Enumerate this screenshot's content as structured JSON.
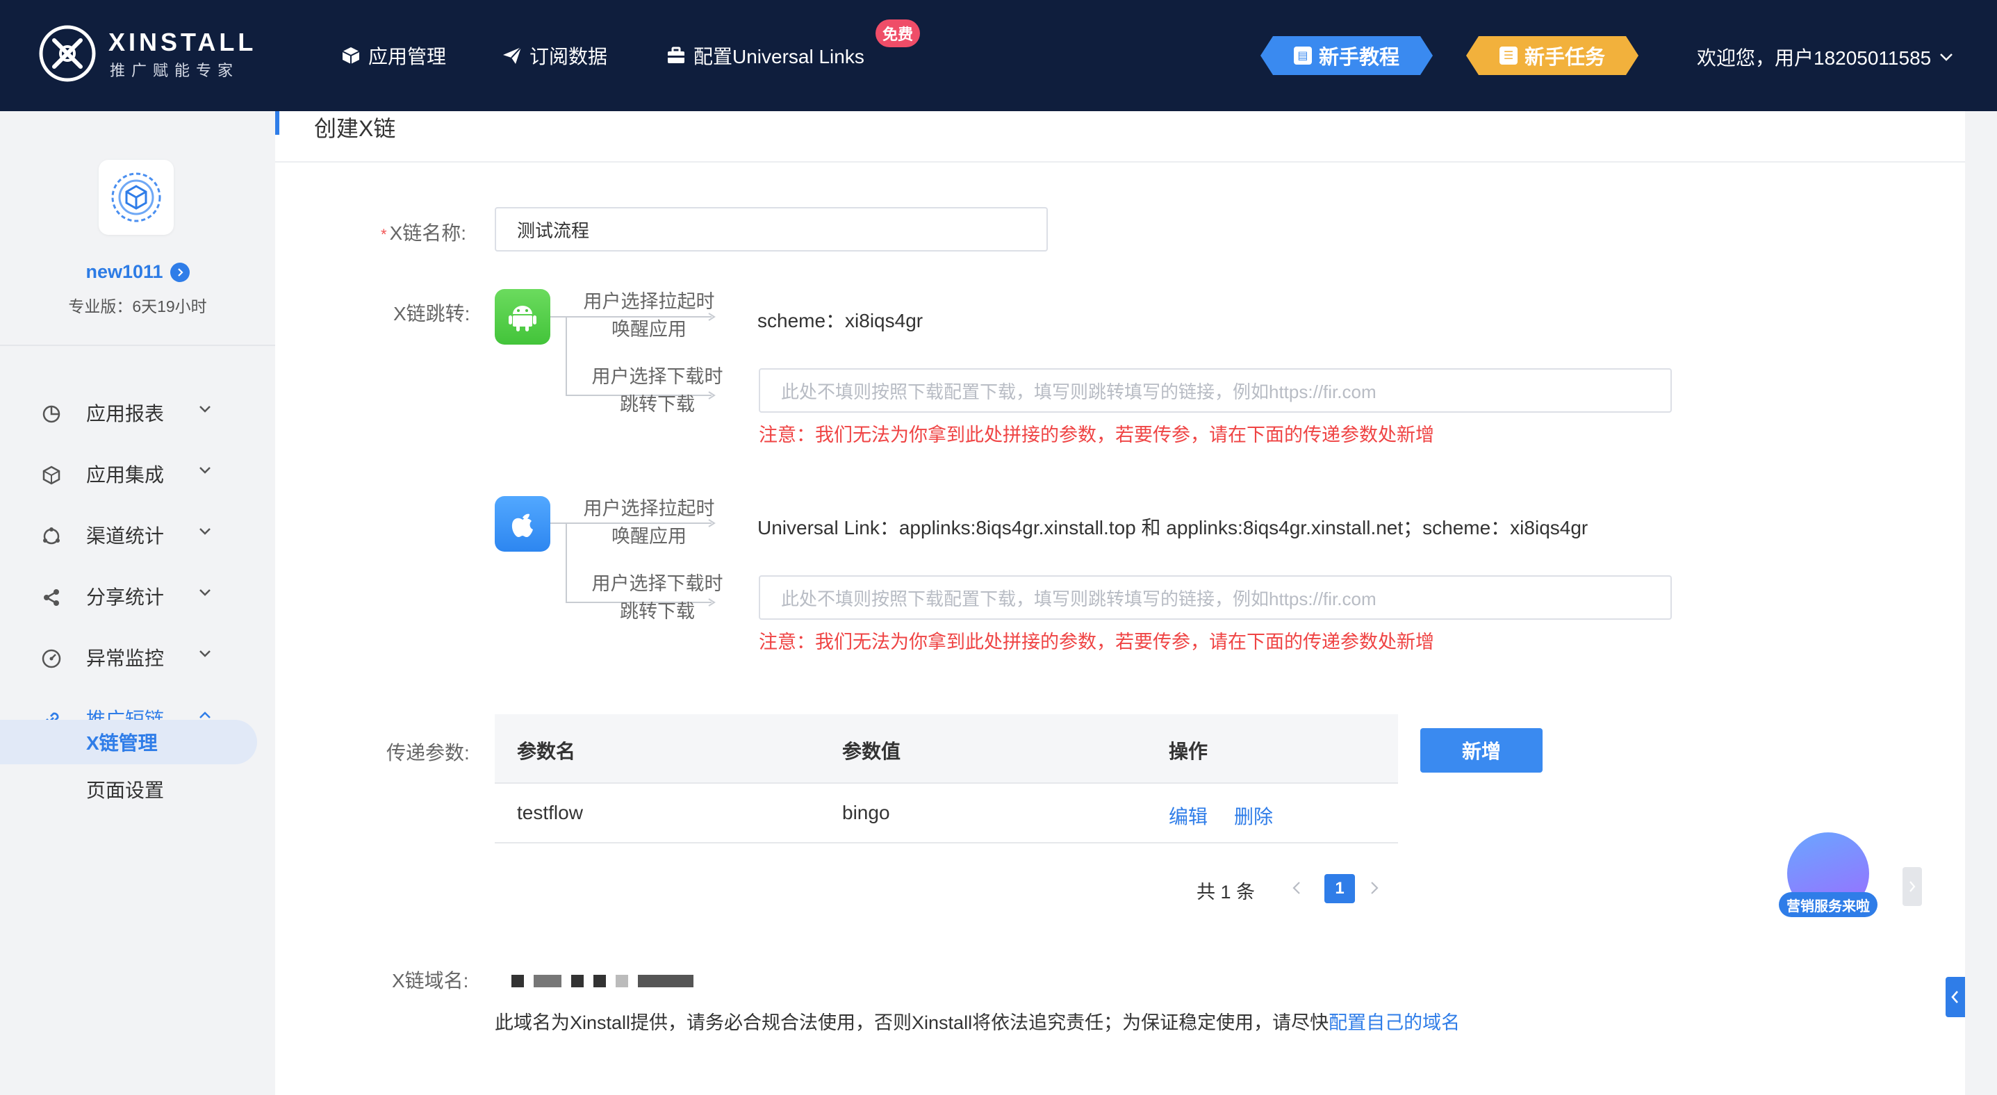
{
  "brand": {
    "name": "XINSTALL",
    "tagline": "推广赋能专家"
  },
  "nav": {
    "items": [
      {
        "label": "应用管理",
        "icon": "cube-icon"
      },
      {
        "label": "订阅数据",
        "icon": "paper-plane-icon"
      },
      {
        "label": "配置Universal Links",
        "icon": "toolbox-icon"
      }
    ],
    "free_badge": "免费",
    "tutorial": "新手教程",
    "task": "新手任务",
    "welcome": "欢迎您，用户18205011585"
  },
  "sidebar": {
    "username": "new1011",
    "plan": "专业版：6天19小时",
    "menu": [
      {
        "label": "应用报表",
        "icon": "pie-chart-icon"
      },
      {
        "label": "应用集成",
        "icon": "box-icon"
      },
      {
        "label": "渠道统计",
        "icon": "channel-icon"
      },
      {
        "label": "分享统计",
        "icon": "share-icon"
      },
      {
        "label": "异常监控",
        "icon": "gauge-icon"
      },
      {
        "label": "推广短链",
        "icon": "link-icon"
      }
    ],
    "submenu": [
      {
        "label": "X链管理"
      },
      {
        "label": "页面设置"
      }
    ]
  },
  "main": {
    "title": "创建X链",
    "name_field": {
      "required_mark": "*",
      "label": "X链名称:",
      "value": "测试流程"
    },
    "jump_label": "X链跳转:",
    "android": {
      "wake_line1": "用户选择拉起时",
      "wake_line2": "唤醒应用",
      "wake_value": "scheme：xi8iqs4gr",
      "download_line1": "用户选择下载时",
      "download_line2": "跳转下载",
      "download_placeholder": "此处不填则按照下载配置下载，填写则跳转填写的链接，例如https://fir.com",
      "warning": "注意：我们无法为你拿到此处拼接的参数，若要传参，请在下面的传递参数处新增"
    },
    "ios": {
      "wake_line1": "用户选择拉起时",
      "wake_line2": "唤醒应用",
      "wake_value": "Universal Link：applinks:8iqs4gr.xinstall.top 和 applinks:8iqs4gr.xinstall.net；scheme：xi8iqs4gr",
      "download_line1": "用户选择下载时",
      "download_line2": "跳转下载",
      "download_placeholder": "此处不填则按照下载配置下载，填写则跳转填写的链接，例如https://fir.com",
      "warning": "注意：我们无法为你拿到此处拼接的参数，若要传参，请在下面的传递参数处新增"
    },
    "params": {
      "label": "传递参数:",
      "columns": [
        "参数名",
        "参数值",
        "操作"
      ],
      "rows": [
        {
          "name": "testflow",
          "value": "bingo",
          "edit": "编辑",
          "delete": "删除"
        }
      ],
      "add_button": "新增",
      "total": "共 1 条",
      "current_page": "1"
    },
    "domain": {
      "label": "X链域名:",
      "note_prefix": "此域名为Xinstall提供，请务必合规合法使用，否则Xinstall将依法追究责任；为保证稳定使用，请尽快",
      "note_link": "配置自己的域名"
    },
    "promo_label": "营销服务来啦"
  }
}
